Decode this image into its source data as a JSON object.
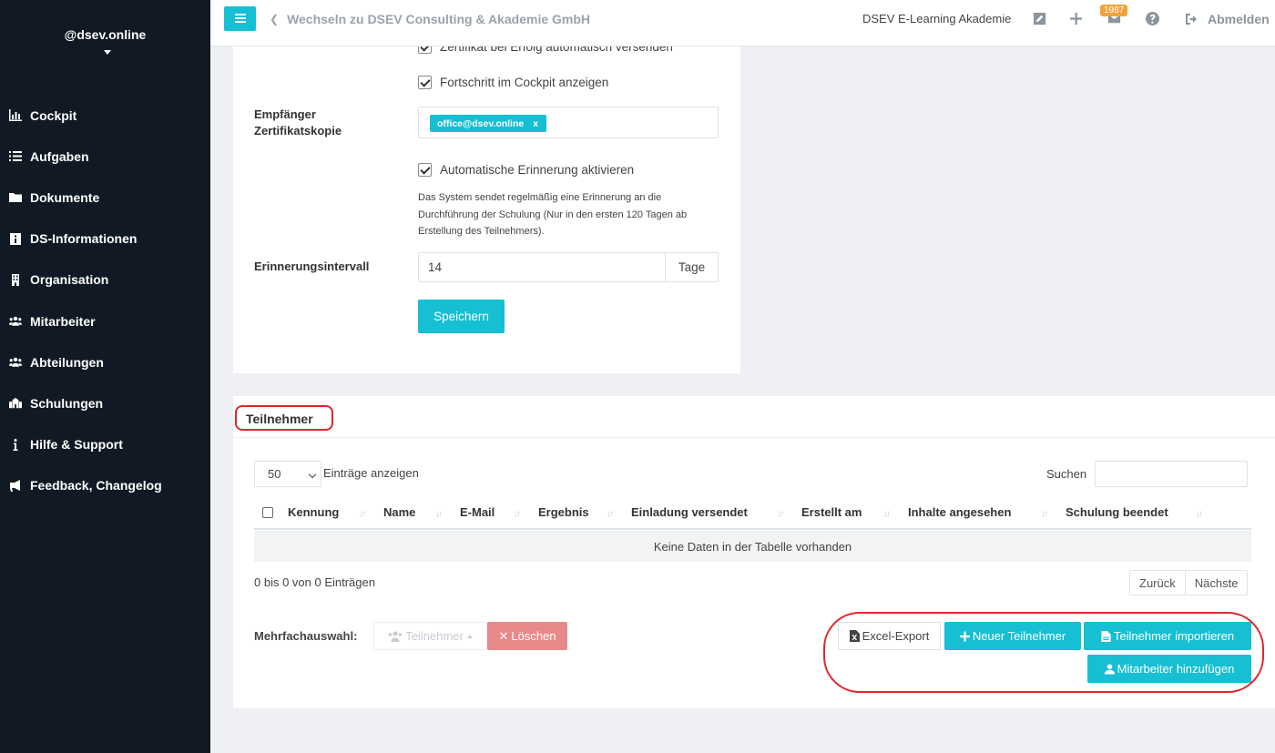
{
  "sidebar": {
    "brand": "@dsev.online",
    "items": [
      {
        "label": "Cockpit",
        "icon": "chart-icon"
      },
      {
        "label": "Aufgaben",
        "icon": "list-icon"
      },
      {
        "label": "Dokumente",
        "icon": "folder-icon"
      },
      {
        "label": "DS-Informationen",
        "icon": "info-icon"
      },
      {
        "label": "Organisation",
        "icon": "building-icon"
      },
      {
        "label": "Mitarbeiter",
        "icon": "users-icon"
      },
      {
        "label": "Abteilungen",
        "icon": "users-icon"
      },
      {
        "label": "Schulungen",
        "icon": "school-icon"
      },
      {
        "label": "Hilfe & Support",
        "icon": "info-i-icon"
      },
      {
        "label": "Feedback, Changelog",
        "icon": "megaphone-icon"
      }
    ]
  },
  "topbar": {
    "switch_link": "Wechseln zu DSEV Consulting & Akademie GmbH",
    "academy": "DSEV E-Learning Akademie",
    "mail_badge": "1987",
    "logout": "Abmelden"
  },
  "settings": {
    "cert_auto_send": "Zertifikat bei Erfolg automatisch versenden",
    "show_progress": "Fortschritt im Cockpit anzeigen",
    "recipient_label_line1": "Empfänger",
    "recipient_label_line2": "Zertifikatskopie",
    "recipient_tag": "office@dsev.online",
    "recipient_tag_remove": "x",
    "auto_reminder": "Automatische Erinnerung aktivieren",
    "reminder_help": "Das System sendet regelmäßig eine Erinnerung an die Durchführung der Schulung (Nur in den ersten 120 Tagen ab Erstellung des Teilnehmers).",
    "interval_label": "Erinnerungsintervall",
    "interval_value": "14",
    "interval_unit": "Tage",
    "save": "Speichern"
  },
  "participants": {
    "title": "Teilnehmer",
    "page_length": "50",
    "length_label": "Einträge anzeigen",
    "search_label": "Suchen",
    "columns": [
      "Kennung",
      "Name",
      "E-Mail",
      "Ergebnis",
      "Einladung versendet",
      "Erstellt am",
      "Inhalte angesehen",
      "Schulung beendet"
    ],
    "empty": "Keine Daten in der Tabelle vorhanden",
    "info": "0 bis 0 von 0 Einträgen",
    "prev": "Zurück",
    "next": "Nächste",
    "multi_label": "Mehrfachauswahl:",
    "multi_select": "Teilnehmer",
    "delete": "Löschen",
    "excel_export": "Excel-Export",
    "new_participant": "Neuer Teilnehmer",
    "import": "Teilnehmer importieren",
    "add_employees": "Mitarbeiter hinzufügen"
  },
  "colors": {
    "accent": "#17bfd3",
    "sidebar": "#111a24",
    "delete": "#e98a8a",
    "annotation": "#e0262c"
  }
}
